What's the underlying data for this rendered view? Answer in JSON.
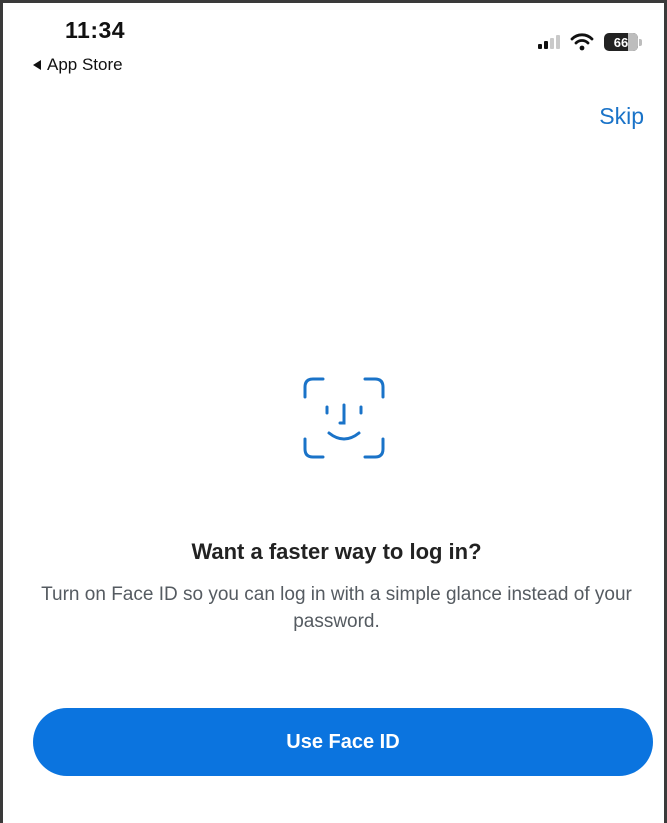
{
  "status_bar": {
    "time": "11:34",
    "back_label": "App Store",
    "battery_level": "66",
    "signal_bars_active": 2,
    "signal_bars_total": 4
  },
  "header": {
    "skip_label": "Skip"
  },
  "main": {
    "icon": "face-id-icon",
    "title": "Want a faster way to log in?",
    "description": "Turn on Face ID so you can log in with a simple glance instead of your password.",
    "primary_button_label": "Use Face ID"
  },
  "colors": {
    "accent": "#0b74df",
    "link": "#1a73c8",
    "title_text": "#222222",
    "body_text": "#555b61"
  }
}
